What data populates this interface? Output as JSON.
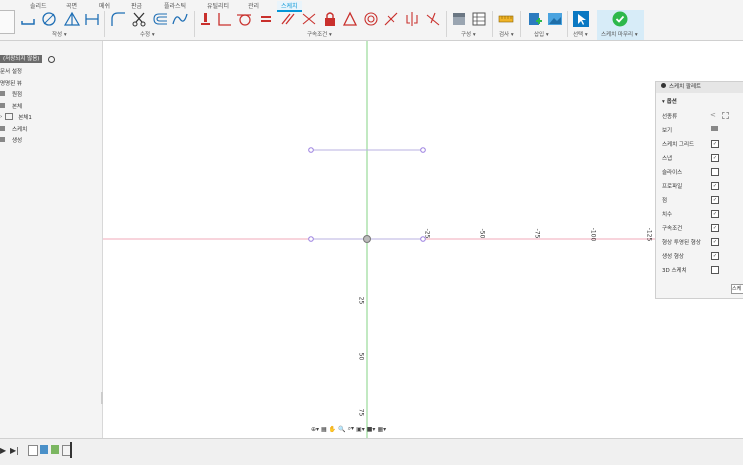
{
  "ribbon": {
    "tabs": [
      "솔리드",
      "곡면",
      "메쉬",
      "판금",
      "플라스틱",
      "유틸리티",
      "관리",
      "스케치"
    ],
    "active_tab": "스케치",
    "groups": [
      "작성 ▾",
      "수정 ▾",
      "구속조건 ▾",
      "구성 ▾",
      "검사 ▾",
      "삽입 ▾",
      "선택 ▾",
      "스케치 마무리 ▾"
    ],
    "finish_color": "#2db84b",
    "accent": "#0696d7"
  },
  "browser": {
    "doc_title": "(저장되지 않음)",
    "items": [
      {
        "label": "문서 설정",
        "icon": "gear-icon"
      },
      {
        "label": "명명된 뷰",
        "icon": "folder-icon"
      },
      {
        "label": "원점",
        "icon": "folder-icon"
      },
      {
        "label": "본체",
        "icon": "folder-icon"
      },
      {
        "label": "본체1",
        "icon": "body-icon"
      },
      {
        "label": "스케치",
        "icon": "folder-icon"
      },
      {
        "label": "생성",
        "icon": "folder-icon"
      }
    ]
  },
  "canvas": {
    "ticks_x": [
      "-25",
      "-50",
      "-75",
      "-100",
      "-125"
    ],
    "ticks_y": [
      "25",
      "50",
      "75"
    ]
  },
  "palette": {
    "title": "스케치 팔레트",
    "section": "옵션",
    "rows": [
      {
        "label": "선종류",
        "control": "icons"
      },
      {
        "label": "보기",
        "control": "icons"
      },
      {
        "label": "스케치 그리드",
        "checked": true
      },
      {
        "label": "스냅",
        "checked": true
      },
      {
        "label": "슬라이스",
        "checked": false
      },
      {
        "label": "프로파일",
        "checked": true
      },
      {
        "label": "점",
        "checked": true
      },
      {
        "label": "치수",
        "checked": true
      },
      {
        "label": "구속조건",
        "checked": true
      },
      {
        "label": "형상 투영된 형상",
        "checked": true
      },
      {
        "label": "생성 형상",
        "checked": true
      },
      {
        "label": "3D 스케치",
        "checked": false
      }
    ],
    "finish_btn": "스케"
  }
}
